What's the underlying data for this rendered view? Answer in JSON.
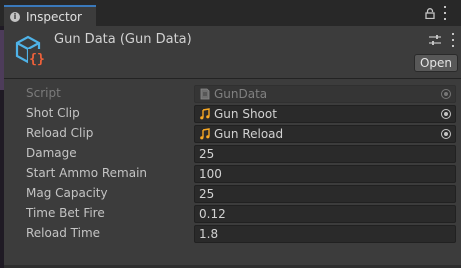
{
  "window": {
    "tab_label": "Inspector"
  },
  "asset": {
    "title": "Gun Data (Gun Data)",
    "open_label": "Open"
  },
  "properties": [
    {
      "label": "Script",
      "value": "GunData",
      "kind": "script",
      "disabled": true
    },
    {
      "label": "Shot Clip",
      "value": "Gun Shoot",
      "kind": "audio"
    },
    {
      "label": "Reload Clip",
      "value": "Gun Reload",
      "kind": "audio"
    },
    {
      "label": "Damage",
      "value": "25",
      "kind": "number"
    },
    {
      "label": "Start Ammo Remain",
      "value": "100",
      "kind": "number"
    },
    {
      "label": "Mag Capacity",
      "value": "25",
      "kind": "number"
    },
    {
      "label": "Time Bet Fire",
      "value": "0.12",
      "kind": "number"
    },
    {
      "label": "Reload Time",
      "value": "1.8",
      "kind": "number"
    }
  ],
  "colors": {
    "accent": "#3a79bb",
    "asset_icon": "#4fb3e8",
    "asset_icon_braces": "#f0613a",
    "audio_icon": "#f5a623"
  },
  "icons": {
    "tab": "info-icon",
    "lock": "lock-icon",
    "settings": "sliders-icon",
    "asset": "scriptable-object-icon",
    "audio": "audio-clip-icon",
    "script": "script-icon",
    "picker": "object-picker-icon"
  }
}
